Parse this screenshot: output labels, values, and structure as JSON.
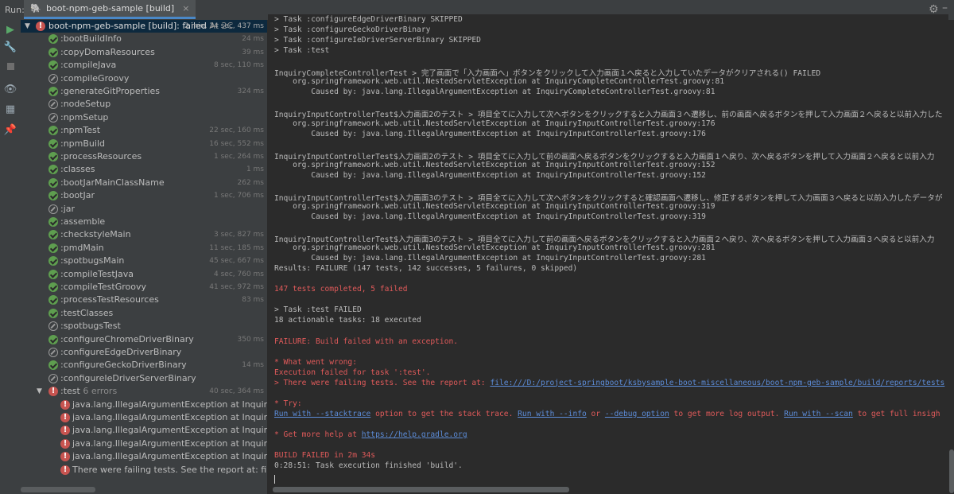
{
  "run_label": "Run:",
  "tab": {
    "title": "boot-npm-geb-sample [build]",
    "close": "×"
  },
  "toolbar": [
    "run-icon",
    "wrench-icon",
    "stop-icon",
    "eye-icon",
    "layout-icon",
    "pin-icon"
  ],
  "tree": {
    "root": {
      "name": "boot-npm-geb-sample [build]:",
      "status_text": "failed",
      "suffix": "At 2C",
      "duration": "2 min, 34 sec, 437 ms"
    },
    "tasks": [
      {
        "name": ":bootBuildInfo",
        "status": "ok",
        "duration": "24 ms"
      },
      {
        "name": ":copyDomaResources",
        "status": "ok",
        "duration": "39 ms"
      },
      {
        "name": ":compileJava",
        "status": "ok",
        "duration": "8 sec, 110 ms"
      },
      {
        "name": ":compileGroovy",
        "status": "skip",
        "duration": ""
      },
      {
        "name": ":generateGitProperties",
        "status": "ok",
        "duration": "324 ms"
      },
      {
        "name": ":nodeSetup",
        "status": "skip",
        "duration": ""
      },
      {
        "name": ":npmSetup",
        "status": "skip",
        "duration": ""
      },
      {
        "name": ":npmTest",
        "status": "ok",
        "duration": "22 sec, 160 ms"
      },
      {
        "name": ":npmBuild",
        "status": "ok",
        "duration": "16 sec, 552 ms"
      },
      {
        "name": ":processResources",
        "status": "ok",
        "duration": "1 sec, 264 ms"
      },
      {
        "name": ":classes",
        "status": "ok",
        "duration": "1 ms"
      },
      {
        "name": ":bootJarMainClassName",
        "status": "ok",
        "duration": "262 ms"
      },
      {
        "name": ":bootJar",
        "status": "ok",
        "duration": "1 sec, 706 ms"
      },
      {
        "name": ":jar",
        "status": "skip",
        "duration": ""
      },
      {
        "name": ":assemble",
        "status": "ok",
        "duration": ""
      },
      {
        "name": ":checkstyleMain",
        "status": "ok",
        "duration": "3 sec, 827 ms"
      },
      {
        "name": ":pmdMain",
        "status": "ok",
        "duration": "11 sec, 185 ms"
      },
      {
        "name": ":spotbugsMain",
        "status": "ok",
        "duration": "45 sec, 667 ms"
      },
      {
        "name": ":compileTestJava",
        "status": "ok",
        "duration": "4 sec, 760 ms"
      },
      {
        "name": ":compileTestGroovy",
        "status": "ok",
        "duration": "41 sec, 972 ms"
      },
      {
        "name": ":processTestResources",
        "status": "ok",
        "duration": "83 ms"
      },
      {
        "name": ":testClasses",
        "status": "ok",
        "duration": ""
      },
      {
        "name": ":spotbugsTest",
        "status": "skip",
        "duration": ""
      },
      {
        "name": ":configureChromeDriverBinary",
        "status": "ok",
        "duration": "350 ms"
      },
      {
        "name": ":configureEdgeDriverBinary",
        "status": "skip",
        "duration": ""
      },
      {
        "name": ":configureGeckoDriverBinary",
        "status": "ok",
        "duration": "14 ms"
      },
      {
        "name": ":configureIeDriverServerBinary",
        "status": "skip",
        "duration": ""
      }
    ],
    "test_node": {
      "name": ":test",
      "errors": "6 errors",
      "duration": "40 sec, 364 ms"
    },
    "errors": [
      "java.lang.IllegalArgumentException at InquiryCompleteC",
      "java.lang.IllegalArgumentException at InquiryInputContro",
      "java.lang.IllegalArgumentException at InquiryInputContro",
      "java.lang.IllegalArgumentException at InquiryInputContro",
      "java.lang.IllegalArgumentException at InquiryInputContro",
      "There were failing tests. See the report at: file:///D:/proje"
    ]
  },
  "console": {
    "lines": [
      {
        "text": "> Task :configureEdgeDriverBinary SKIPPED",
        "kind": "normal"
      },
      {
        "text": "> Task :configureGeckoDriverBinary",
        "kind": "normal"
      },
      {
        "text": "> Task :configureIeDriverServerBinary SKIPPED",
        "kind": "normal"
      },
      {
        "text": "> Task :test",
        "kind": "normal"
      },
      {
        "text": "",
        "kind": "normal"
      },
      {
        "text": "InquiryCompleteControllerTest > 完了画面で「入力画面へ」ボタンをクリックして入力画面１へ戻ると入力していたデータがクリアされる() FAILED",
        "kind": "normal"
      },
      {
        "text": "    org.springframework.web.util.NestedServletException at InquiryCompleteControllerTest.groovy:81",
        "kind": "normal"
      },
      {
        "text": "        Caused by: java.lang.IllegalArgumentException at InquiryCompleteControllerTest.groovy:81",
        "kind": "normal"
      },
      {
        "text": "",
        "kind": "normal"
      },
      {
        "text": "InquiryInputControllerTest$入力画面2のテスト > 項目全てに入力して次へボタンをクリックすると入力画面３へ遷移し、前の画面へ戻るボタンを押して入力画面２へ戻ると以前入力した",
        "kind": "normal"
      },
      {
        "text": "    org.springframework.web.util.NestedServletException at InquiryInputControllerTest.groovy:176",
        "kind": "normal"
      },
      {
        "text": "        Caused by: java.lang.IllegalArgumentException at InquiryInputControllerTest.groovy:176",
        "kind": "normal"
      },
      {
        "text": "",
        "kind": "normal"
      },
      {
        "text": "InquiryInputControllerTest$入力画面2のテスト > 項目全てに入力して前の画面へ戻るボタンをクリックすると入力画面１へ戻り、次へ戻るボタンを押して入力画面２へ戻ると以前入力",
        "kind": "normal"
      },
      {
        "text": "    org.springframework.web.util.NestedServletException at InquiryInputControllerTest.groovy:152",
        "kind": "normal"
      },
      {
        "text": "        Caused by: java.lang.IllegalArgumentException at InquiryInputControllerTest.groovy:152",
        "kind": "normal"
      },
      {
        "text": "",
        "kind": "normal"
      },
      {
        "text": "InquiryInputControllerTest$入力画面3のテスト > 項目全てに入力して次へボタンをクリックすると確認画面へ遷移し、修正するボタンを押して入力画面３へ戻ると以前入力したデータが",
        "kind": "normal"
      },
      {
        "text": "    org.springframework.web.util.NestedServletException at InquiryInputControllerTest.groovy:319",
        "kind": "normal"
      },
      {
        "text": "        Caused by: java.lang.IllegalArgumentException at InquiryInputControllerTest.groovy:319",
        "kind": "normal"
      },
      {
        "text": "",
        "kind": "normal"
      },
      {
        "text": "InquiryInputControllerTest$入力画面3のテスト > 項目全てに入力して前の画面へ戻るボタンをクリックすると入力画面２へ戻り、次へ戻るボタンを押して入力画面３へ戻ると以前入力",
        "kind": "normal"
      },
      {
        "text": "    org.springframework.web.util.NestedServletException at InquiryInputControllerTest.groovy:281",
        "kind": "normal"
      },
      {
        "text": "        Caused by: java.lang.IllegalArgumentException at InquiryInputControllerTest.groovy:281",
        "kind": "normal"
      },
      {
        "text": "Results: FAILURE (147 tests, 142 successes, 5 failures, 0 skipped)",
        "kind": "normal"
      },
      {
        "text": "",
        "kind": "normal"
      },
      {
        "text": "147 tests completed, 5 failed",
        "kind": "red"
      },
      {
        "text": "",
        "kind": "normal"
      },
      {
        "text": "> Task :test FAILED",
        "kind": "normal"
      },
      {
        "text": "18 actionable tasks: 18 executed",
        "kind": "normal"
      },
      {
        "text": "",
        "kind": "normal"
      },
      {
        "text": "FAILURE: Build failed with an exception.",
        "kind": "red"
      },
      {
        "text": "",
        "kind": "normal"
      },
      {
        "text": "* What went wrong:",
        "kind": "red"
      },
      {
        "text": "Execution failed for task ':test'.",
        "kind": "red"
      },
      {
        "text": "> There were failing tests. See the report at: ",
        "kind": "red",
        "link": "file:///D:/project-springboot/ksbysample-boot-miscellaneous/boot-npm-geb-sample/build/reports/tests"
      },
      {
        "text": "",
        "kind": "normal"
      },
      {
        "text": "* Try:",
        "kind": "red"
      },
      {
        "kind": "try",
        "parts": [
          {
            "t": "Run with --stacktrace",
            "link": true
          },
          {
            "t": " option to get the stack trace. ",
            "link": false
          },
          {
            "t": "Run with --info",
            "link": true
          },
          {
            "t": " or ",
            "link": false
          },
          {
            "t": "--debug option",
            "link": true
          },
          {
            "t": " to get more log output. ",
            "link": false
          },
          {
            "t": "Run with --scan",
            "link": true
          },
          {
            "t": " to get full insigh",
            "link": false
          }
        ]
      },
      {
        "text": "",
        "kind": "normal"
      },
      {
        "text": "* Get more help at ",
        "kind": "red",
        "link": "https://help.gradle.org"
      },
      {
        "text": "",
        "kind": "normal"
      },
      {
        "text": "BUILD FAILED in 2m 34s",
        "kind": "red"
      },
      {
        "text": "0:28:51: Task execution finished 'build'.",
        "kind": "normal"
      }
    ]
  }
}
